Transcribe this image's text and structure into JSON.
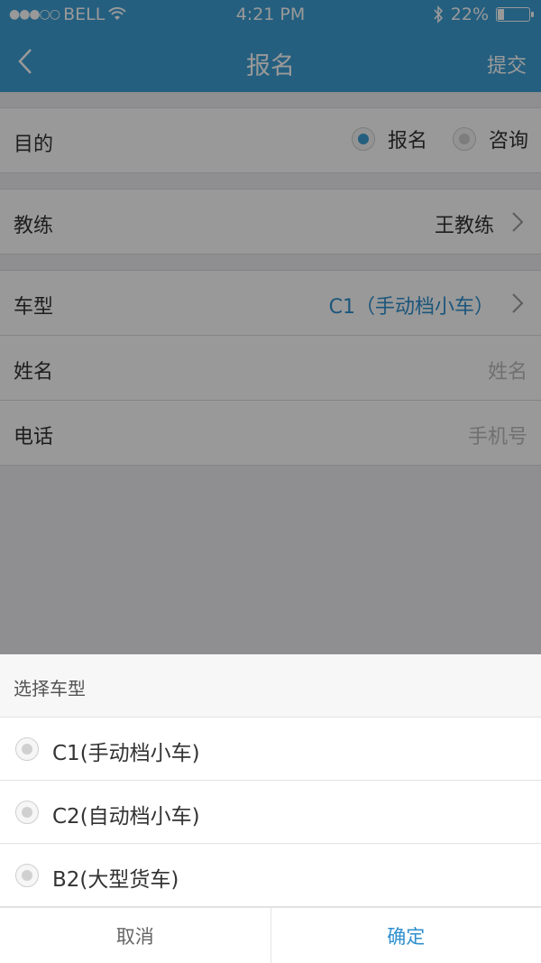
{
  "status_bar": {
    "signal_dots": "●●●○○",
    "carrier": "BELL",
    "time": "4:21 PM",
    "battery_text": "22%",
    "battery_level": 0.22
  },
  "nav": {
    "title": "报名",
    "submit_label": "提交"
  },
  "form": {
    "purpose": {
      "label": "目的",
      "options": [
        "报名",
        "咨询"
      ],
      "selected": "报名"
    },
    "coach": {
      "label": "教练",
      "value": "王教练"
    },
    "car_type": {
      "label": "车型",
      "value": "C1（手动档小车）"
    },
    "name": {
      "label": "姓名",
      "placeholder": "姓名"
    },
    "phone": {
      "label": "电话",
      "placeholder": "手机号"
    }
  },
  "sheet": {
    "title": "选择车型",
    "options": [
      "C1(手动档小车)",
      "C2(自动档小车)",
      "B2(大型货车)"
    ],
    "cancel_label": "取消",
    "confirm_label": "确定"
  },
  "colors": {
    "accent": "#3d9ed4",
    "link": "#2f8fce"
  }
}
